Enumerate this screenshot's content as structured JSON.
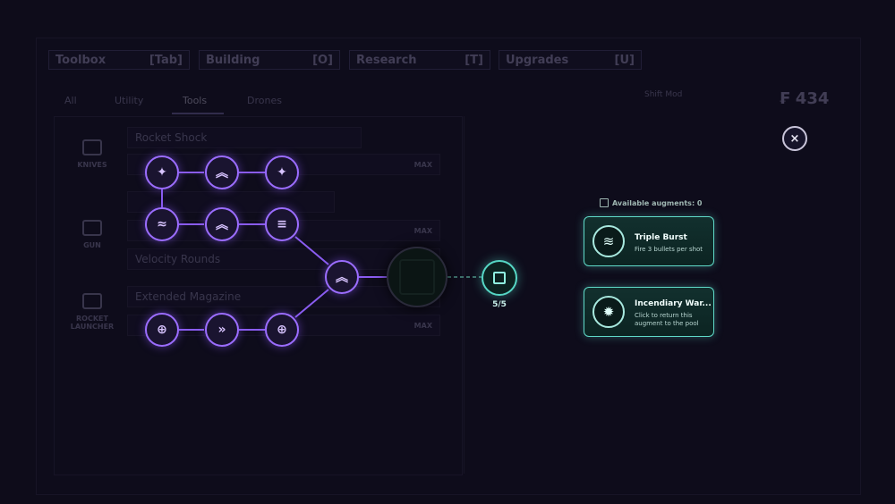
{
  "background": {
    "top_tabs": [
      {
        "label": "Toolbox",
        "key": "[Tab]"
      },
      {
        "label": "Building",
        "key": "[O]"
      },
      {
        "label": "Research",
        "key": "[T]"
      },
      {
        "label": "Upgrades",
        "key": "[U]"
      }
    ],
    "sub_tabs": [
      "All",
      "Utility",
      "Tools",
      "Drones"
    ],
    "categories": [
      {
        "label": "KNIVES"
      },
      {
        "label": "GUN"
      },
      {
        "label": "ROCKET LAUNCHER"
      }
    ],
    "rows": [
      {
        "label": "Rocket Shock",
        "max": ""
      },
      {
        "label": "",
        "max": "MAX"
      },
      {
        "label": "",
        "max": ""
      },
      {
        "label": "",
        "max": "MAX"
      },
      {
        "label": "Velocity Rounds",
        "max": ""
      },
      {
        "label": "Extended Magazine",
        "max": ""
      },
      {
        "label": "",
        "max": "MAX"
      }
    ],
    "shift_label": "Shift Mod",
    "currency": "434"
  },
  "close_label": "×",
  "augment": {
    "available_label": "Available augments: 0",
    "count": "5/5"
  },
  "cards": [
    {
      "title": "Triple Burst",
      "desc": "Fire 3 bullets per shot",
      "icon": "burst-icon"
    },
    {
      "title": "Incendiary War...",
      "desc": "Click to return this augment to the pool",
      "icon": "fire-icon"
    }
  ],
  "nodes": [
    {
      "icon": "flame-icon",
      "glyph": "✦"
    },
    {
      "icon": "chevron-up-icon",
      "glyph": "︽"
    },
    {
      "icon": "flame-icon",
      "glyph": "✦"
    },
    {
      "icon": "wave-icon",
      "glyph": "≈"
    },
    {
      "icon": "chevron-up-icon",
      "glyph": "︽"
    },
    {
      "icon": "list-up-icon",
      "glyph": "≡"
    },
    {
      "icon": "chevron-up-icon",
      "glyph": "︽"
    },
    {
      "icon": "arrow-up-circle-icon",
      "glyph": "⊕"
    },
    {
      "icon": "fast-forward-icon",
      "glyph": "»"
    },
    {
      "icon": "arrow-up-circle-icon",
      "glyph": "⊕"
    }
  ]
}
